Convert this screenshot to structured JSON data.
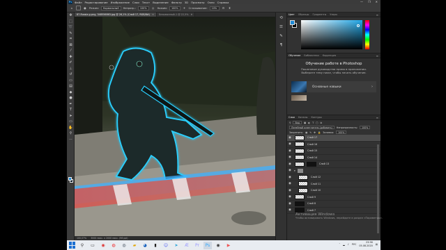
{
  "menubar": {
    "logo": "Ps",
    "items": [
      "Файл",
      "Редактирование",
      "Изображение",
      "Слои",
      "Текст",
      "Выделение",
      "Фильтр",
      "3D",
      "Просмотр",
      "Окно",
      "Справка"
    ],
    "window_controls": [
      "—",
      "❐",
      "✕"
    ]
  },
  "options": {
    "mode_label": "Режим:",
    "mode_value": "Нормальный",
    "opacity_label": "Непрозр.:",
    "opacity_value": "100%",
    "pressure_label": "Нажим:",
    "pressure_value": "100%",
    "smoothing_label": "Сглаживание:",
    "smoothing_value": "10%"
  },
  "tabs": [
    {
      "label": "87-Russia-g.png, 348556863.jpg @ 26,1% (Слой 17, RGB/8#)",
      "close": "✕"
    },
    {
      "label": "Безымянный-1 @ 22,5%",
      "close": "✕"
    }
  ],
  "status": {
    "zoom": "100,07%",
    "doc": "3000 пикс. х 2000 пикс. (96 ppi)"
  },
  "color_panel": {
    "tabs": [
      "Цвет",
      "Образцы",
      "Градиенты",
      "Узоры"
    ],
    "fg": "#1e8ad6",
    "bg": "#000000"
  },
  "learn_panel": {
    "tabs": [
      "Обучение",
      "Библиотеки",
      "Коррекция"
    ],
    "title": "Обучение работе в Photoshop",
    "body": "Пошаговые руководства прямо в приложении. Выберите тему ниже, чтобы начать обучение.",
    "card_label": "Основные навыки",
    "card_arrow": "›"
  },
  "layers_panel": {
    "tabs": [
      "Слои",
      "Каналы",
      "Контуры"
    ],
    "kind_label": "Вид",
    "blend_value": "Линейный осветлитель (добавить)",
    "opacity_label": "Непрозрачность:",
    "opacity_value": "100%",
    "lock_label": "Закрепить:",
    "fill_label": "Заливка:",
    "fill_value": "100%",
    "layers": [
      {
        "name": "Слой 17",
        "selected": true,
        "type": "pixel"
      },
      {
        "name": "Слой 16",
        "selected": false,
        "type": "pixel"
      },
      {
        "name": "Слой 15",
        "selected": false,
        "type": "pixel"
      },
      {
        "name": "Слой 14",
        "selected": false,
        "type": "pixel"
      },
      {
        "name": "Слой 13",
        "selected": false,
        "type": "mask"
      },
      {
        "name": "",
        "selected": false,
        "type": "group"
      },
      {
        "name": "Слой 12",
        "selected": false,
        "type": "pixel"
      },
      {
        "name": "Слой 11",
        "selected": false,
        "type": "pixel"
      },
      {
        "name": "Слой 10",
        "selected": false,
        "type": "pixel"
      },
      {
        "name": "Слой 9",
        "selected": false,
        "type": "pixel"
      },
      {
        "name": "Слой 8",
        "selected": false,
        "type": "dark"
      },
      {
        "name": "Слой 7",
        "selected": false,
        "type": "dark"
      }
    ]
  },
  "taskbar": {
    "tray_lang": "РУС",
    "time": "23:56",
    "date": "05.08.2020"
  },
  "watermark": {
    "title": "Активация Windows",
    "sub": "Чтобы активировать Windows, перейдите в раздел «Параметры»."
  }
}
